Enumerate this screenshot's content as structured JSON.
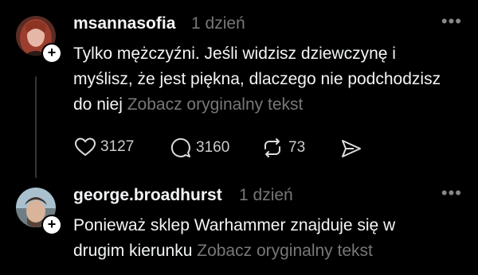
{
  "posts": [
    {
      "username": "msannasofia",
      "time": "1 dzień",
      "text": "Tylko mężczyźni. Jeśli widzisz dziewczynę i myślisz, że jest piękna, dlaczego nie podchodzisz do niej",
      "translate_label": "Zobacz oryginalny tekst",
      "stats": {
        "likes": "3127",
        "comments": "3160",
        "reposts": "73"
      }
    },
    {
      "username": "george.broadhurst",
      "time": "1 dzień",
      "text": "Ponieważ sklep Warhammer znajduje się w drugim kierunku",
      "translate_label": "Zobacz oryginalny tekst"
    }
  ],
  "icons": [
    "plus-icon",
    "more-icon",
    "heart-icon",
    "comment-icon",
    "repost-icon",
    "share-icon"
  ],
  "colors": {
    "background": "#000000",
    "text": "#f3f5f7",
    "muted": "#777777"
  }
}
